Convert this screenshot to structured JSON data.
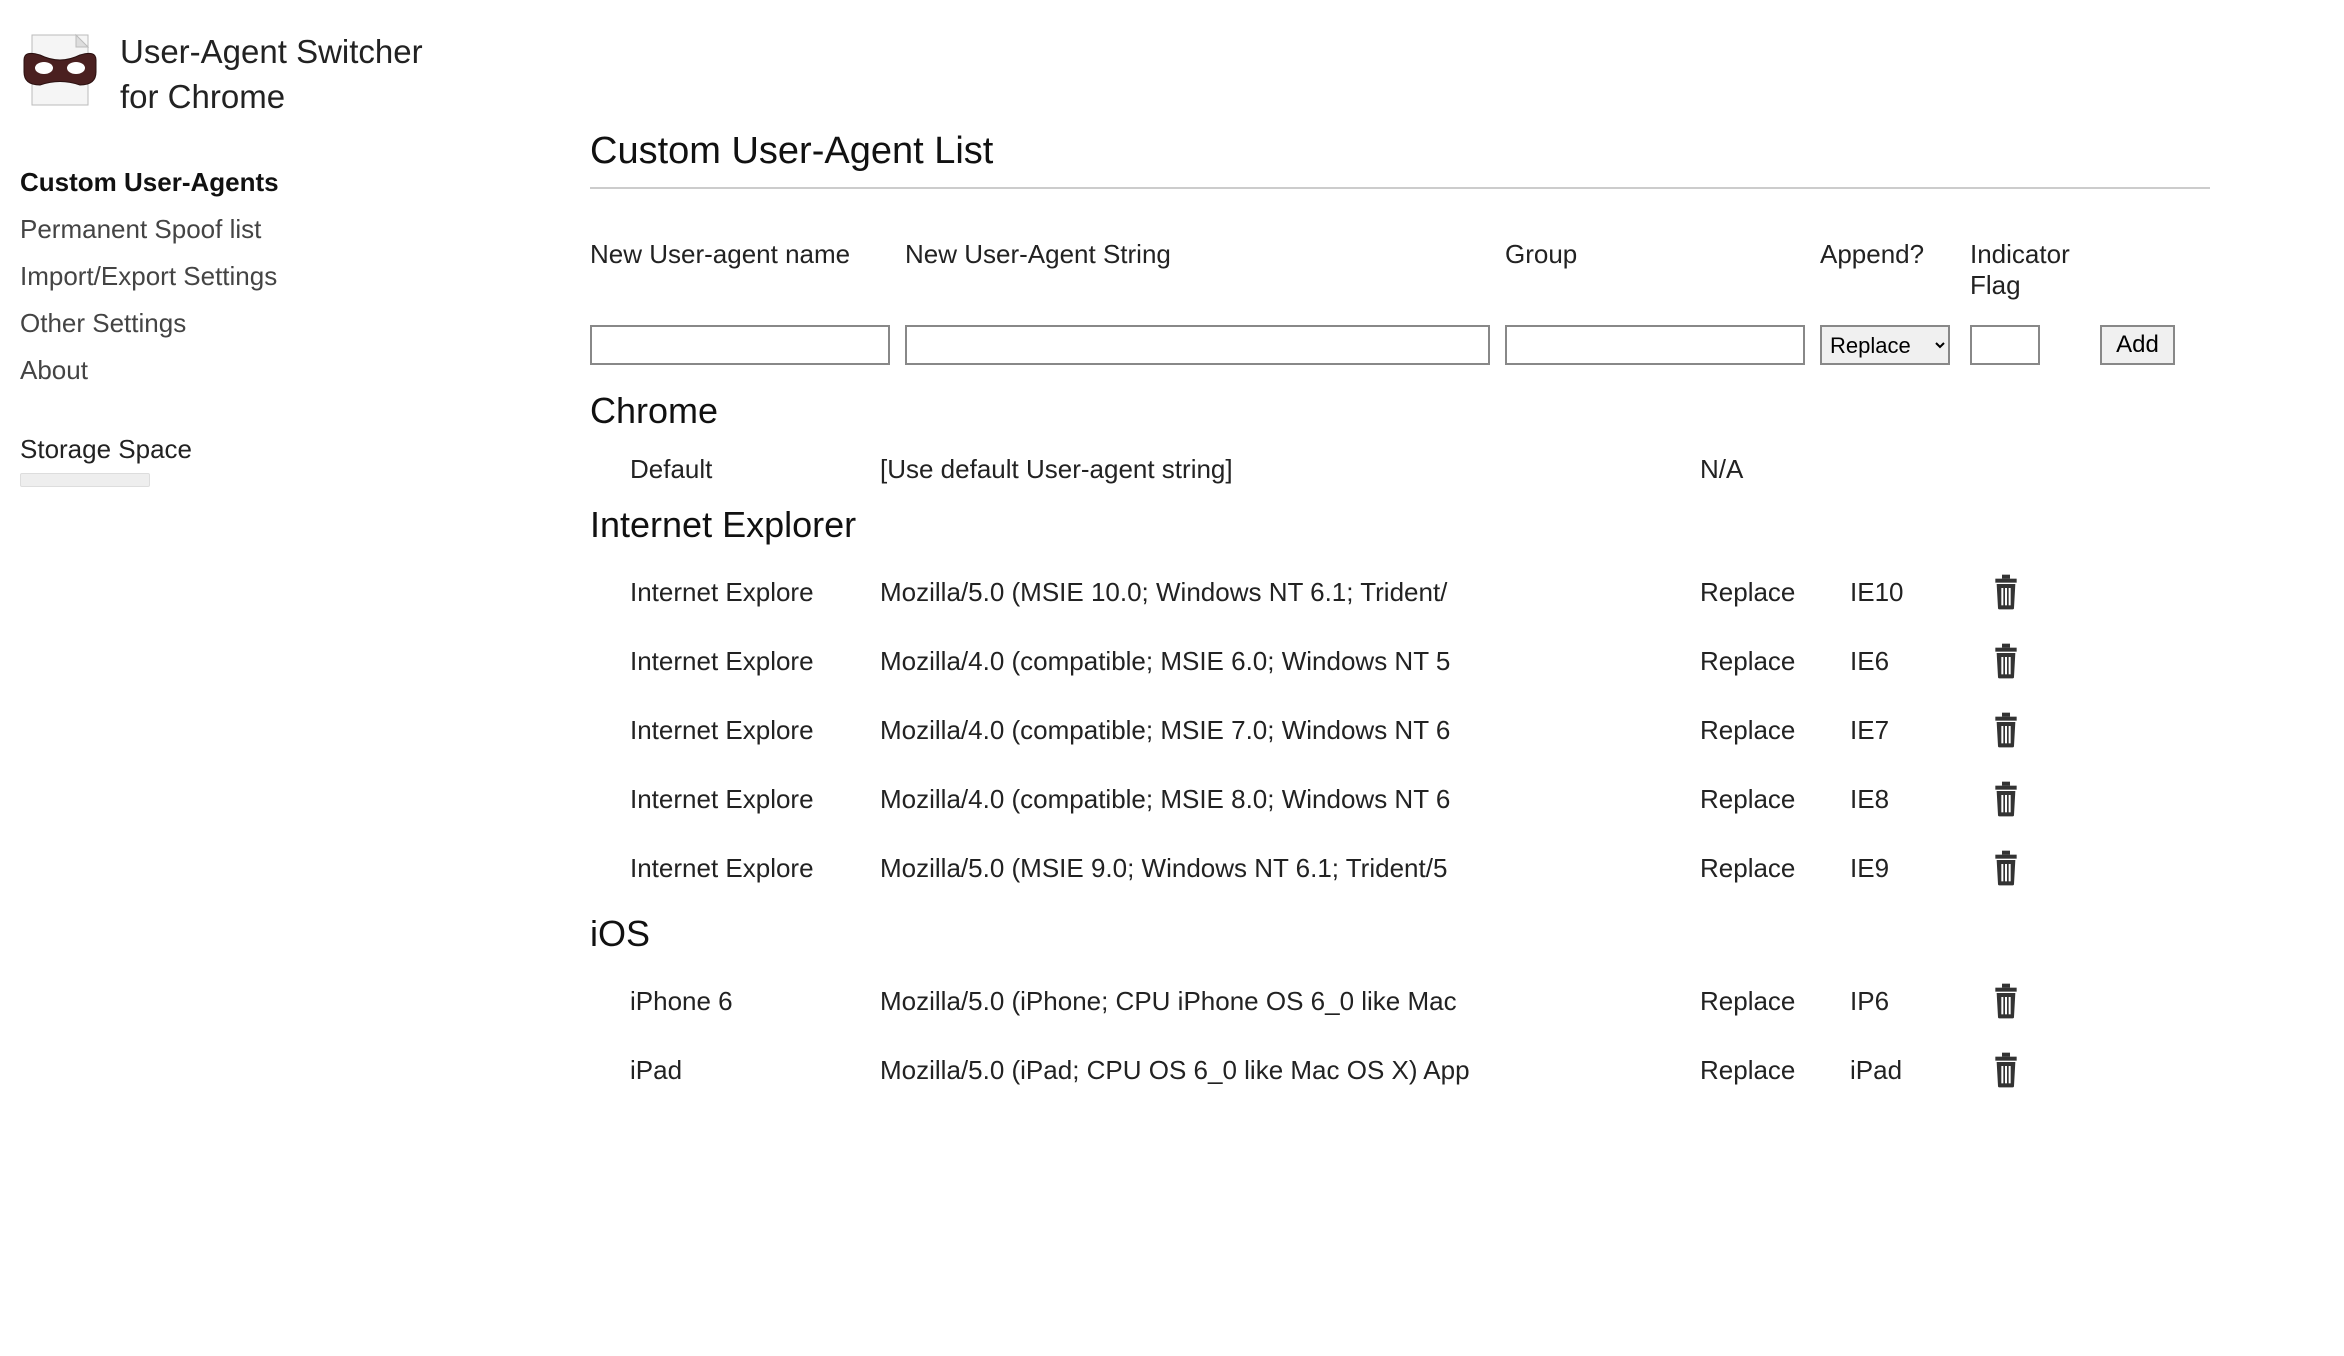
{
  "logo": {
    "title_line1": "User-Agent Switcher",
    "title_line2": "for Chrome"
  },
  "sidebar": {
    "items": [
      {
        "label": "Custom User-Agents",
        "active": true
      },
      {
        "label": "Permanent Spoof list",
        "active": false
      },
      {
        "label": "Import/Export Settings",
        "active": false
      },
      {
        "label": "Other Settings",
        "active": false
      },
      {
        "label": "About",
        "active": false
      }
    ],
    "storage_label": "Storage Space"
  },
  "main": {
    "title": "Custom User-Agent List",
    "headers": {
      "name": "New User-agent name",
      "string": "New User-Agent String",
      "group": "Group",
      "append": "Append?",
      "flag": "Indicator Flag"
    },
    "select_append": "Replace",
    "add_button": "Add",
    "groups": [
      {
        "name": "Chrome",
        "entries": [
          {
            "name": "Default",
            "string": "[Use default User-agent string]",
            "append": "N/A",
            "flag": "",
            "deletable": false
          }
        ]
      },
      {
        "name": "Internet Explorer",
        "entries": [
          {
            "name": "Internet Explore",
            "string": "Mozilla/5.0 (MSIE 10.0; Windows NT 6.1; Trident/",
            "append": "Replace",
            "flag": "IE10",
            "deletable": true
          },
          {
            "name": "Internet Explore",
            "string": "Mozilla/4.0 (compatible; MSIE 6.0; Windows NT 5",
            "append": "Replace",
            "flag": "IE6",
            "deletable": true
          },
          {
            "name": "Internet Explore",
            "string": "Mozilla/4.0 (compatible; MSIE 7.0; Windows NT 6",
            "append": "Replace",
            "flag": "IE7",
            "deletable": true
          },
          {
            "name": "Internet Explore",
            "string": "Mozilla/4.0 (compatible; MSIE 8.0; Windows NT 6",
            "append": "Replace",
            "flag": "IE8",
            "deletable": true
          },
          {
            "name": "Internet Explore",
            "string": "Mozilla/5.0 (MSIE 9.0; Windows NT 6.1; Trident/5",
            "append": "Replace",
            "flag": "IE9",
            "deletable": true
          }
        ]
      },
      {
        "name": "iOS",
        "entries": [
          {
            "name": "iPhone 6",
            "string": "Mozilla/5.0 (iPhone; CPU iPhone OS 6_0 like Mac",
            "append": "Replace",
            "flag": "IP6",
            "deletable": true
          },
          {
            "name": "iPad",
            "string": "Mozilla/5.0 (iPad; CPU OS 6_0 like Mac OS X) App",
            "append": "Replace",
            "flag": "iPad",
            "deletable": true
          }
        ]
      }
    ]
  }
}
